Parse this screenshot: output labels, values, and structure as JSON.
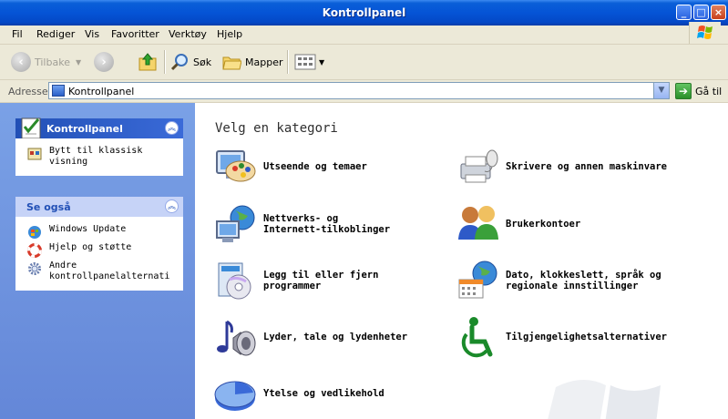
{
  "window": {
    "title": "Kontrollpanel"
  },
  "menu": [
    "Fil",
    "Rediger",
    "Vis",
    "Favoritter",
    "Verktøy",
    "Hjelp"
  ],
  "toolbar": {
    "back": "Tilbake",
    "search": "Søk",
    "folders": "Mapper"
  },
  "address": {
    "label": "Adresse",
    "value": "Kontrollpanel",
    "go": "Gå til"
  },
  "panel": {
    "title": "Kontrollpanel",
    "classic_line1": "Bytt til klassisk",
    "classic_line2": "visning"
  },
  "seealso": {
    "title": "Se også",
    "items": [
      "Windows Update",
      "Hjelp og støtte",
      "Andre",
      "kontrollpanelalternati"
    ]
  },
  "main": {
    "heading": "Velg en kategori",
    "categories": [
      {
        "line1": "Utseende og temaer",
        "line2": "",
        "icon": "appearance-icon"
      },
      {
        "line1": "Skrivere og annen maskinvare",
        "line2": "",
        "icon": "printer-icon"
      },
      {
        "line1": "Nettverks- og",
        "line2": "Internett-tilkoblinger",
        "icon": "network-icon"
      },
      {
        "line1": "Brukerkontoer",
        "line2": "",
        "icon": "users-icon"
      },
      {
        "line1": "Legg til eller fjern",
        "line2": "programmer",
        "icon": "add-remove-programs-icon"
      },
      {
        "line1": "Dato, klokkeslett, språk og",
        "line2": "regionale innstillinger",
        "icon": "date-time-icon"
      },
      {
        "line1": "Lyder, tale og lydenheter",
        "line2": "",
        "icon": "sounds-icon"
      },
      {
        "line1": "Tilgjengelighetsalternativer",
        "line2": "",
        "icon": "accessibility-icon"
      },
      {
        "line1": "Ytelse og vedlikehold",
        "line2": "",
        "icon": "performance-icon"
      }
    ]
  },
  "colors": {
    "titlebar": "#0554d6",
    "leftpane": "#6c8fdd",
    "boxheader": "#2250b6"
  }
}
